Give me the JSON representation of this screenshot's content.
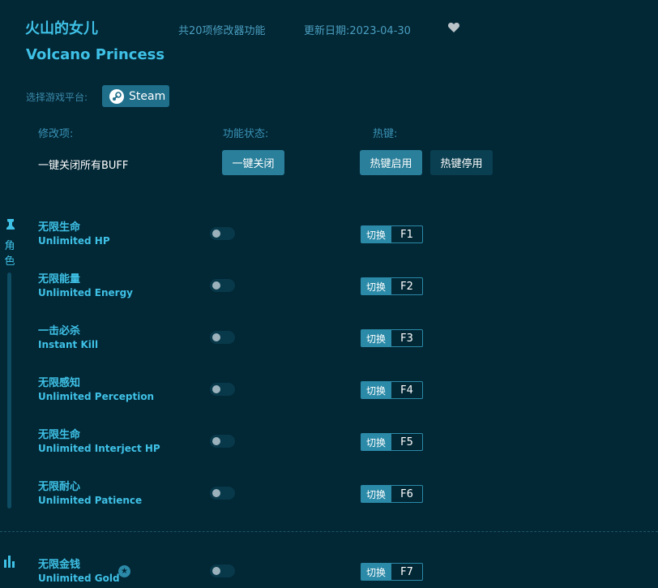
{
  "header": {
    "title_cn": "火山的女儿",
    "title_en": "Volcano Princess",
    "feature_count": "共20项修改器功能",
    "update_date": "更新日期:2023-04-30"
  },
  "platform": {
    "label": "选择游戏平台:",
    "steam_label": "Steam"
  },
  "columns": {
    "item": "修改项:",
    "status": "功能状态:",
    "hotkey": "热键:"
  },
  "global": {
    "label": "一键关闭所有BUFF",
    "close_all_button": "一键关闭",
    "hotkey_enable_button": "热键启用",
    "hotkey_disable_button": "热键停用"
  },
  "sections": [
    {
      "icon": "character-icon",
      "label": "角色"
    },
    {
      "icon": "bar-chart-icon",
      "label": ""
    }
  ],
  "items": [
    {
      "cn": "无限生命",
      "en": "Unlimited HP",
      "hotkey_action": "切换",
      "key": "F1",
      "enabled": false
    },
    {
      "cn": "无限能量",
      "en": "Unlimited Energy",
      "hotkey_action": "切换",
      "key": "F2",
      "enabled": false
    },
    {
      "cn": "一击必杀",
      "en": "Instant Kill",
      "hotkey_action": "切换",
      "key": "F3",
      "enabled": false
    },
    {
      "cn": "无限感知",
      "en": "Unlimited Perception",
      "hotkey_action": "切换",
      "key": "F4",
      "enabled": false
    },
    {
      "cn": "无限生命",
      "en": "Unlimited Interject HP",
      "hotkey_action": "切换",
      "key": "F5",
      "enabled": false
    },
    {
      "cn": "无限耐心",
      "en": "Unlimited Patience",
      "hotkey_action": "切换",
      "key": "F6",
      "enabled": false
    },
    {
      "cn": "无限金钱",
      "en": "Unlimited Gold",
      "hotkey_action": "切换",
      "key": "F7",
      "enabled": false
    }
  ],
  "colors": {
    "background": "#022735",
    "accent": "#3fc1e6",
    "button": "#2a7f9b"
  }
}
